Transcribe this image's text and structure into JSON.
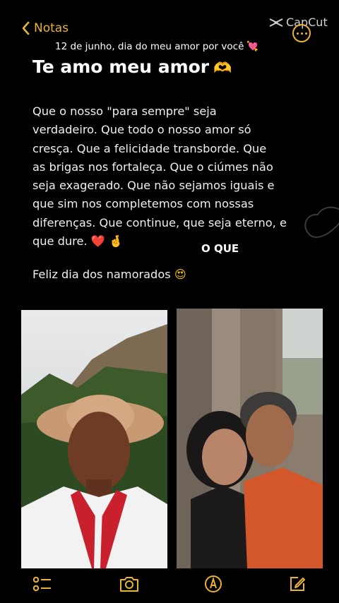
{
  "nav": {
    "back_label": "Notas"
  },
  "watermark": {
    "label": "CapCut"
  },
  "note": {
    "caption": "12 de junho, dia do meu amor por você",
    "title": "Te amo meu amor",
    "lines": [
      "Que o nosso \"para sempre\" seja",
      "verdadeiro. Que todo o nosso amor só",
      "cresça. Que a felicidade transborde. Que",
      "as brigas nos fortaleça. Que o ciúmes não",
      "seja exagerado. Que não sejamos iguais e",
      "que sim nos completemos com nossas",
      "diferenças. Que continue, que seja eterno, e",
      "que dure."
    ],
    "overlay_text": "O QUE",
    "closing": "Feliz dia dos namorados"
  },
  "colors": {
    "accent": "#e9b431",
    "background": "#000000"
  },
  "toolbar": {
    "icons": [
      "checklist-icon",
      "camera-icon",
      "markup-icon",
      "compose-icon"
    ]
  }
}
